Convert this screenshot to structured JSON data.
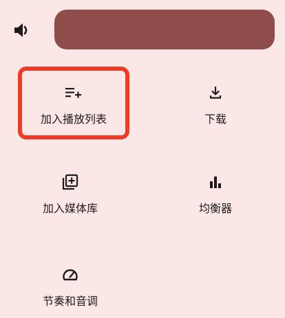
{
  "volume": {
    "icon": "volume-up-icon",
    "slider_color": "#8e4d4b"
  },
  "actions": [
    {
      "label": "加入播放列表",
      "icon": "playlist-add-icon"
    },
    {
      "label": "下载",
      "icon": "download-icon"
    },
    {
      "label": "加入媒体库",
      "icon": "library-add-icon"
    },
    {
      "label": "均衡器",
      "icon": "equalizer-icon"
    },
    {
      "label": "节奏和音调",
      "icon": "speed-icon"
    }
  ],
  "colors": {
    "background": "#fbe8e6",
    "highlight": "#ee3b26"
  }
}
